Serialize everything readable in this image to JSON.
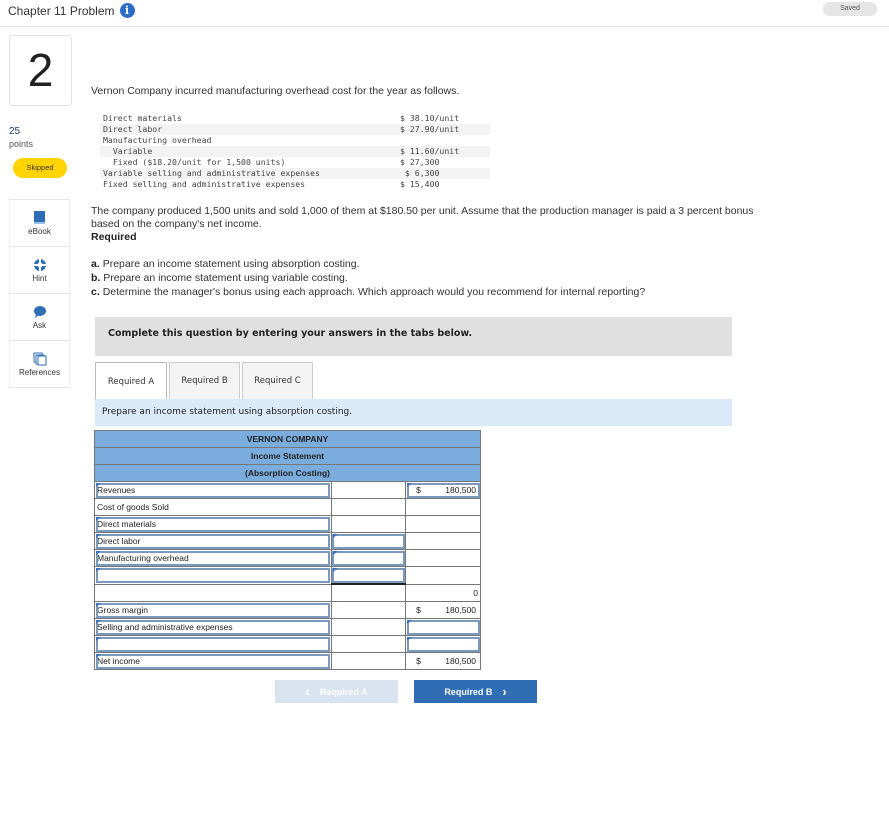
{
  "header": {
    "title": "Chapter 11 Problem",
    "info_icon": "i",
    "saved_label": "Saved"
  },
  "question": {
    "number": "2",
    "points_value": "25",
    "points_label": "points",
    "status": "Skipped"
  },
  "tools": [
    {
      "label": "eBook",
      "icon": "book-icon"
    },
    {
      "label": "Hint",
      "icon": "lifebuoy-icon"
    },
    {
      "label": "Ask",
      "icon": "speech-bubble-icon"
    },
    {
      "label": "References",
      "icon": "documents-icon"
    }
  ],
  "problem": {
    "intro": "Vernon Company incurred manufacturing overhead cost for the year as follows.",
    "given": [
      {
        "label": "Direct materials",
        "value": "$ 38.10/unit"
      },
      {
        "label": "Direct labor",
        "value": "$ 27.90/unit"
      },
      {
        "label": "Manufacturing overhead",
        "value": ""
      },
      {
        "label": "  Variable",
        "value": "$ 11.60/unit"
      },
      {
        "label": "  Fixed ($18.20/unit for 1,500 units)",
        "value": "$ 27,300"
      },
      {
        "label": "Variable selling and administrative expenses",
        "value": " $ 6,300"
      },
      {
        "label": "Fixed selling and administrative expenses",
        "value": "$ 15,400"
      }
    ],
    "paragraph": "The company produced 1,500 units and sold 1,000 of them at $180.50 per unit. Assume that the production manager is paid a 3 percent bonus based on the company's net income.",
    "required_heading": "Required",
    "requirements": [
      {
        "letter": "a.",
        "text": "Prepare an income statement using absorption costing."
      },
      {
        "letter": "b.",
        "text": "Prepare an income statement using variable costing."
      },
      {
        "letter": "c.",
        "text": "Determine the manager's bonus using each approach. Which approach would you recommend for internal reporting?"
      }
    ]
  },
  "answer_area": {
    "instruction": "Complete this question by entering your answers in the tabs below.",
    "tabs": [
      {
        "label": "Required A",
        "active": true
      },
      {
        "label": "Required B",
        "active": false
      },
      {
        "label": "Required C",
        "active": false
      }
    ],
    "tab_description": "Prepare an income statement using absorption costing."
  },
  "statement": {
    "company": "VERNON COMPANY",
    "title": "Income Statement",
    "subtitle": "(Absorption Costing)",
    "rows": [
      {
        "label": "Revenues",
        "mid": "",
        "cur": "$",
        "amount": "180,500"
      },
      {
        "label": "Cost of goods Sold",
        "mid": "",
        "cur": "",
        "amount": ""
      },
      {
        "label": "Direct materials",
        "mid": "",
        "cur": "",
        "amount": ""
      },
      {
        "label": "Direct labor",
        "mid": "",
        "cur": "",
        "amount": ""
      },
      {
        "label": "Manufacturing overhead",
        "mid": "",
        "cur": "",
        "amount": ""
      },
      {
        "label": "",
        "mid": "",
        "cur": "",
        "amount": ""
      },
      {
        "label": "",
        "mid": "",
        "cur": "",
        "amount": "0"
      },
      {
        "label": "Gross margin",
        "mid": "",
        "cur": "$",
        "amount": "180,500"
      },
      {
        "label": "Selling and administrative expenses",
        "mid": "",
        "cur": "",
        "amount": ""
      },
      {
        "label": "",
        "mid": "",
        "cur": "",
        "amount": ""
      },
      {
        "label": "Net income",
        "mid": "",
        "cur": "$",
        "amount": "180,500"
      }
    ]
  },
  "navigation": {
    "prev_label": "Required A",
    "next_label": "Required B",
    "prev_icon": "‹",
    "next_icon": "›"
  },
  "colors": {
    "accent": "#2f6db5",
    "header_fill": "#7aacde",
    "skipped_badge": "#ffd400",
    "tab_desc_bg": "#dbeaf8"
  }
}
